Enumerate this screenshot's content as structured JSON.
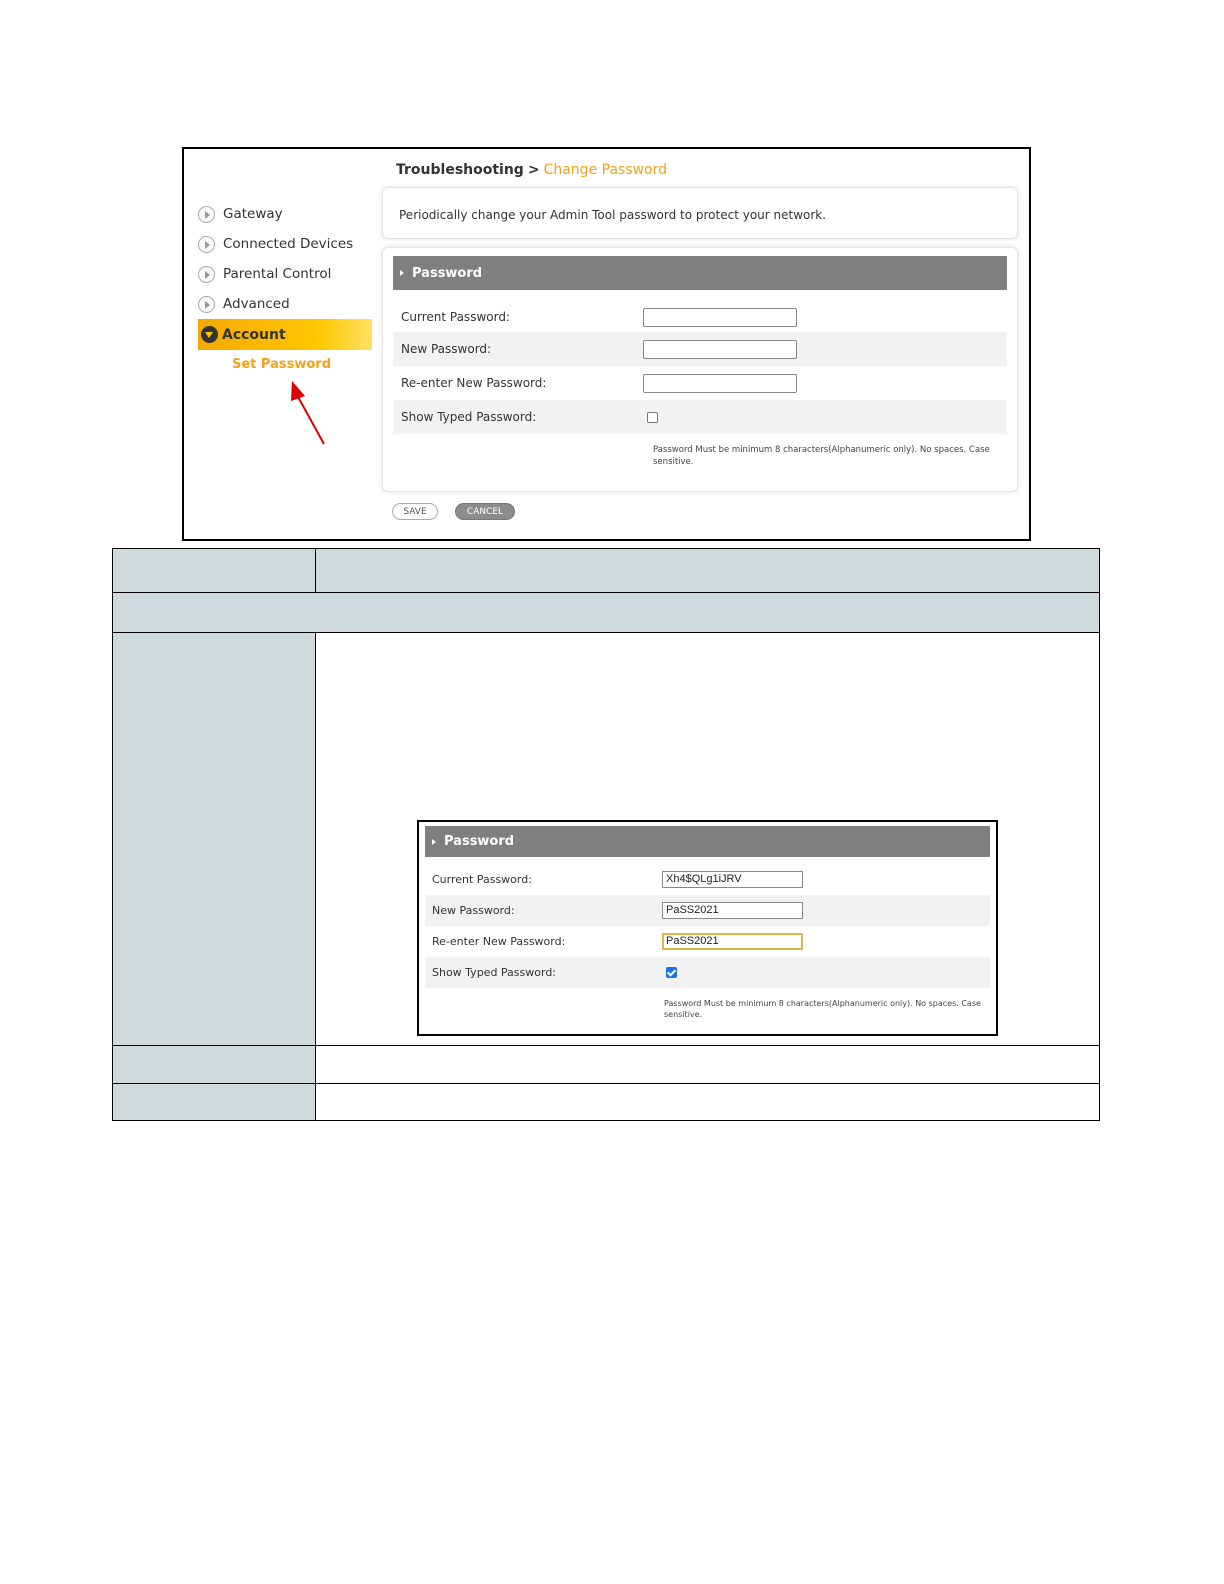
{
  "breadcrumb": {
    "section": "Troubleshooting",
    "separator": ">",
    "current": "Change Password"
  },
  "nav": {
    "items": [
      {
        "label": "Gateway"
      },
      {
        "label": "Connected Devices"
      },
      {
        "label": "Parental Control"
      },
      {
        "label": "Advanced"
      }
    ],
    "active": "Account",
    "subitem": "Set Password"
  },
  "intro": "Periodically change your Admin Tool password to protect your network.",
  "form": {
    "section_title": "Password",
    "current_label": "Current Password:",
    "new_label": "New Password:",
    "reenter_label": "Re-enter New Password:",
    "show_label": "Show Typed Password:",
    "hint": "Password Must be minimum 8 characters(Alphanumeric only). No spaces. Case sensitive."
  },
  "buttons": {
    "save": "SAVE",
    "cancel": "CANCEL"
  },
  "example": {
    "section_title": "Password",
    "current_label": "Current Password:",
    "current_value": "Xh4$QLg1iJRV",
    "new_label": "New Password:",
    "new_value": "PaSS2021",
    "reenter_label": "Re-enter New Password:",
    "reenter_value": "PaSS2021",
    "show_label": "Show Typed Password:",
    "hint": "Password Must be minimum 8 characters(Alphanumeric only). No spaces. Case sensitive."
  }
}
